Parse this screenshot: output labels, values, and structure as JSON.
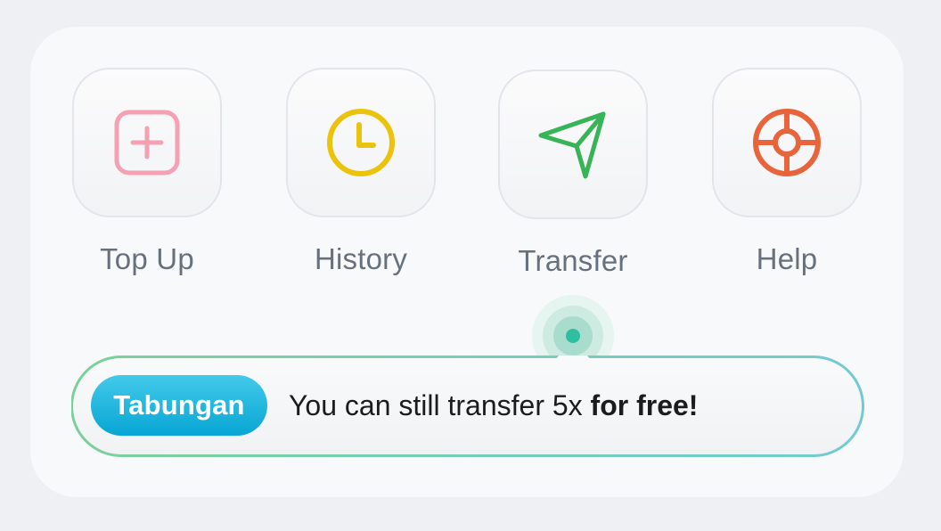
{
  "actions": [
    {
      "label": "Top Up",
      "icon": "plus-square-icon",
      "color": "#f5a0b3"
    },
    {
      "label": "History",
      "icon": "clock-icon",
      "color": "#ebc30c"
    },
    {
      "label": "Transfer",
      "icon": "send-icon",
      "color": "#37b455"
    },
    {
      "label": "Help",
      "icon": "lifebuoy-icon",
      "color": "#e8643a"
    }
  ],
  "promo": {
    "badge": "Tabungan",
    "message": "You can still transfer 5x ",
    "emphasis": "for free!",
    "accent_start": "#7dd09a",
    "accent_end": "#72cbd2",
    "badge_color": "#0aa8d6"
  }
}
